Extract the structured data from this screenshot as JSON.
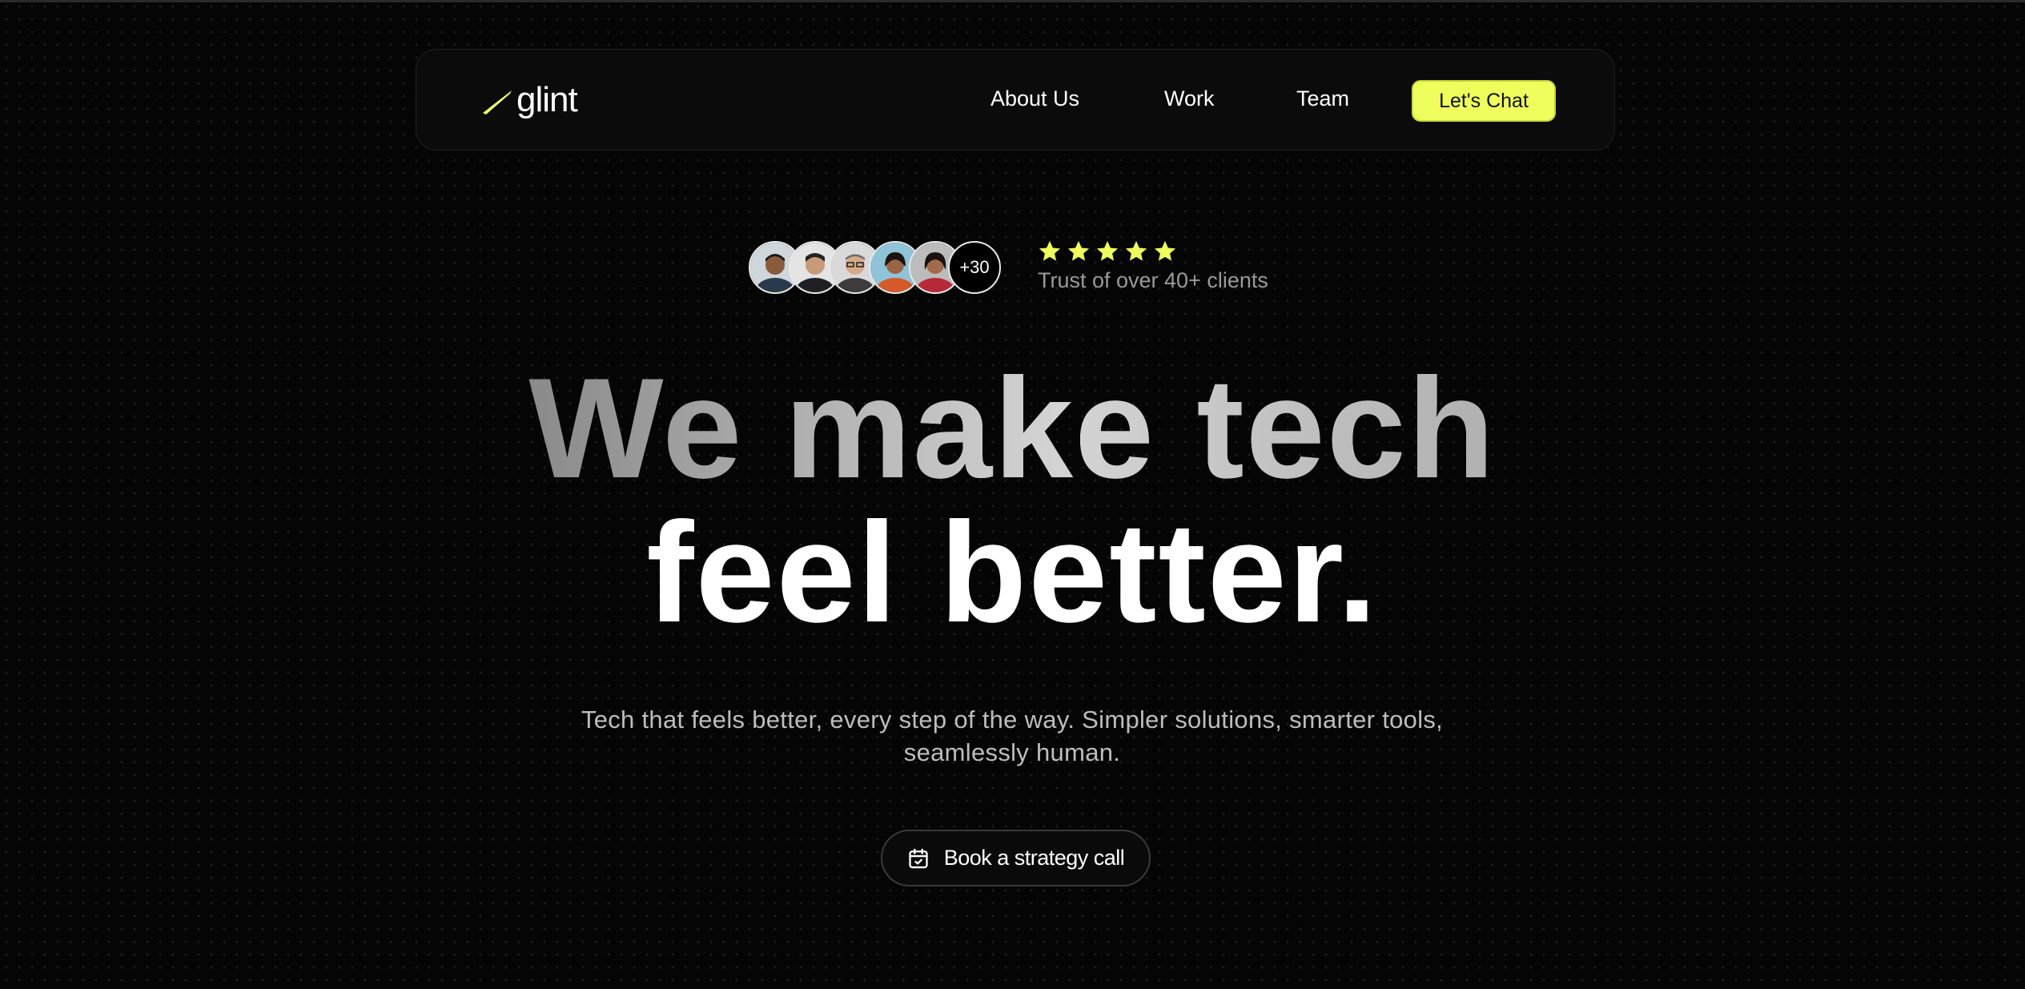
{
  "brand": {
    "name": "glint",
    "accent_color": "#eefe5c",
    "background_color": "#050505"
  },
  "nav": {
    "links": [
      {
        "label": "About Us"
      },
      {
        "label": "Work"
      },
      {
        "label": "Team"
      }
    ],
    "cta_label": "Let's Chat"
  },
  "social_proof": {
    "avatars": [
      "avatar-1",
      "avatar-2",
      "avatar-3",
      "avatar-4",
      "avatar-5"
    ],
    "more_count": "+30",
    "rating_stars": 5,
    "trust_text": "Trust of over 40+ clients"
  },
  "hero": {
    "headline_line1": "We make tech",
    "headline_line2": "feel better.",
    "subtext": "Tech that feels better, every step of the way. Simpler solutions, smarter tools, seamlessly human.",
    "cta_label": "Book a strategy call",
    "cta_icon": "calendar-icon"
  }
}
